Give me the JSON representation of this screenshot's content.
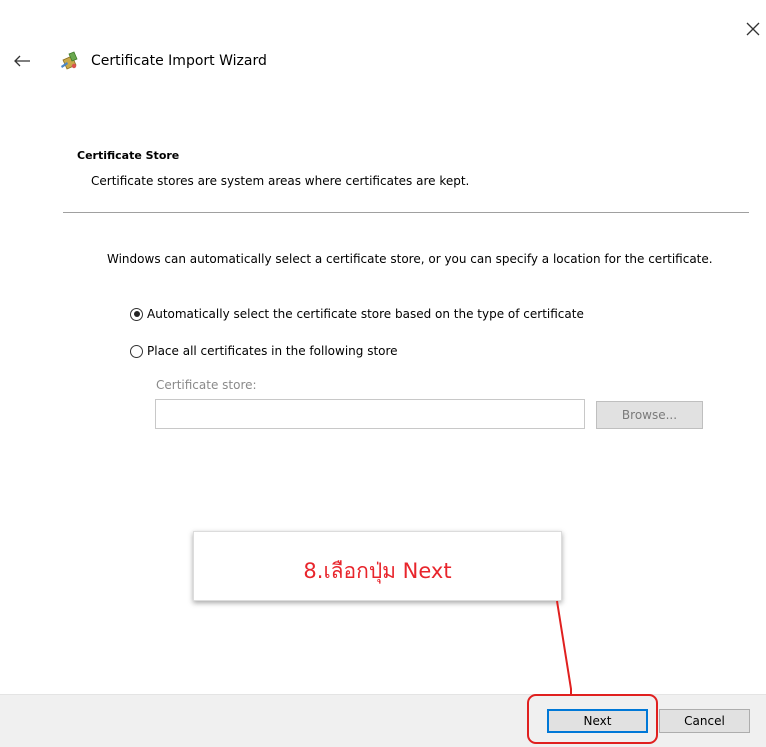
{
  "window": {
    "title": "Certificate Import Wizard",
    "close_icon": "close-icon",
    "back_icon": "back-arrow-icon",
    "app_icon": "certificate-wizard-icon"
  },
  "section": {
    "title": "Certificate Store",
    "description": "Certificate stores are system areas where certificates are kept."
  },
  "body": {
    "intro": "Windows can automatically select a certificate store, or you can specify a location for the certificate.",
    "options": [
      {
        "label": "Automatically select the certificate store based on the type of certificate",
        "selected": true
      },
      {
        "label": "Place all certificates in the following store",
        "selected": false
      }
    ],
    "store_field_label": "Certificate store:",
    "store_field_value": "",
    "browse_label": "Browse..."
  },
  "callout": {
    "text": "8.เลือกปุ่ม Next",
    "color": "#e8252c"
  },
  "footer": {
    "next_label": "Next",
    "cancel_label": "Cancel"
  },
  "colors": {
    "accent": "#0078d7",
    "annotation": "#e0201f"
  }
}
